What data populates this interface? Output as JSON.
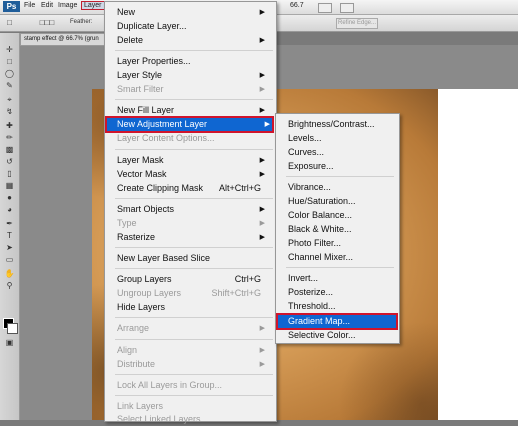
{
  "menubar": {
    "logo": "Ps",
    "items": [
      "File",
      "Edit",
      "Image",
      "Layer"
    ],
    "zoom": "66.7"
  },
  "options": {
    "feather_label": "Feather:",
    "refine_edge": "Refine Edge..."
  },
  "document": {
    "tab_title": "stamp effect @ 66.7% (grun"
  },
  "layer_menu": {
    "items": [
      {
        "label": "New",
        "submenu": true
      },
      {
        "label": "Duplicate Layer..."
      },
      {
        "label": "Delete",
        "submenu": true
      },
      {
        "label": "Layer Properties..."
      },
      {
        "label": "Layer Style",
        "submenu": true
      },
      {
        "label": "Smart Filter",
        "submenu": true,
        "disabled": true
      },
      {
        "label": "New Fill Layer",
        "submenu": true
      },
      {
        "label": "New Adjustment Layer",
        "submenu": true,
        "highlighted": true
      },
      {
        "label": "Layer Content Options...",
        "disabled": true
      },
      {
        "label": "Layer Mask",
        "submenu": true
      },
      {
        "label": "Vector Mask",
        "submenu": true
      },
      {
        "label": "Create Clipping Mask",
        "shortcut": "Alt+Ctrl+G"
      },
      {
        "label": "Smart Objects",
        "submenu": true
      },
      {
        "label": "Type",
        "submenu": true,
        "disabled": true
      },
      {
        "label": "Rasterize",
        "submenu": true
      },
      {
        "label": "New Layer Based Slice"
      },
      {
        "label": "Group Layers",
        "shortcut": "Ctrl+G"
      },
      {
        "label": "Ungroup Layers",
        "shortcut": "Shift+Ctrl+G",
        "disabled": true
      },
      {
        "label": "Hide Layers"
      },
      {
        "label": "Arrange",
        "submenu": true,
        "disabled": true
      },
      {
        "label": "Align",
        "submenu": true,
        "disabled": true
      },
      {
        "label": "Distribute",
        "submenu": true,
        "disabled": true
      },
      {
        "label": "Lock All Layers in Group...",
        "disabled": true
      },
      {
        "label": "Link Layers",
        "disabled": true
      },
      {
        "label": "Select Linked Layers",
        "disabled": true
      }
    ]
  },
  "adjustment_submenu": {
    "items": [
      {
        "label": "Brightness/Contrast..."
      },
      {
        "label": "Levels..."
      },
      {
        "label": "Curves..."
      },
      {
        "label": "Exposure..."
      },
      {
        "label": "Vibrance..."
      },
      {
        "label": "Hue/Saturation..."
      },
      {
        "label": "Color Balance..."
      },
      {
        "label": "Black & White..."
      },
      {
        "label": "Photo Filter..."
      },
      {
        "label": "Channel Mixer..."
      },
      {
        "label": "Invert..."
      },
      {
        "label": "Posterize..."
      },
      {
        "label": "Threshold..."
      },
      {
        "label": "Gradient Map...",
        "highlighted": true
      },
      {
        "label": "Selective Color..."
      }
    ]
  },
  "colors": {
    "highlight": "#0f66d1",
    "callout_outline": "#d0142c",
    "foreground": "#000000",
    "background": "#ffffff"
  },
  "icons": [
    "move-icon",
    "marquee-icon",
    "lasso-icon",
    "quick-select-icon",
    "crop-icon",
    "eyedropper-icon",
    "healing-brush-icon",
    "brush-icon",
    "clone-stamp-icon",
    "history-brush-icon",
    "eraser-icon",
    "gradient-icon",
    "blur-icon",
    "dodge-icon",
    "pen-icon",
    "type-icon",
    "path-select-icon",
    "shape-icon",
    "hand-icon",
    "zoom-icon"
  ]
}
